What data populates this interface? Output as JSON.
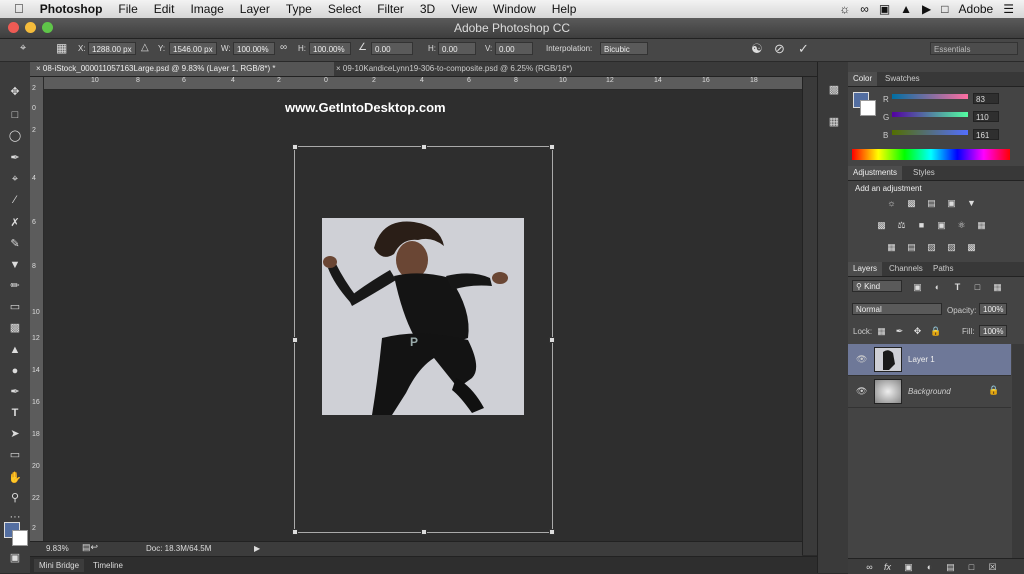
{
  "menubar": {
    "app": "Photoshop",
    "items": [
      "File",
      "Edit",
      "Image",
      "Layer",
      "Type",
      "Select",
      "Filter",
      "3D",
      "View",
      "Window",
      "Help"
    ],
    "right_label": "Adobe"
  },
  "window": {
    "title": "Adobe Photoshop CC"
  },
  "options_bar": {
    "x_label": "X:",
    "x_value": "1288.00 px",
    "y_label": "Y:",
    "y_value": "1546.00 px",
    "w_label": "W:",
    "w_value": "100.00%",
    "h_label": "H:",
    "h_value": "100.00%",
    "angle_value": "0.00",
    "hskew_label": "H:",
    "hskew_value": "0.00",
    "vskew_label": "V:",
    "vskew_value": "0.00",
    "interpolation_label": "Interpolation:",
    "interpolation_value": "Bicubic",
    "workspace": "Essentials"
  },
  "tabs": [
    {
      "label": "08-iStock_000011057163Large.psd @ 9.83% (Layer 1, RGB/8*) *",
      "active": true
    },
    {
      "label": "09-10KandiceLynn19-306-to-composite.psd @ 6.25% (RGB/16*)",
      "active": false
    }
  ],
  "ruler_top": [
    "10",
    "8",
    "6",
    "4",
    "2",
    "0",
    "2",
    "4",
    "6",
    "8",
    "10",
    "12",
    "14",
    "16",
    "18"
  ],
  "ruler_left": [
    "2",
    "0",
    "2",
    "4",
    "6",
    "8",
    "10",
    "12",
    "14",
    "16",
    "18",
    "20",
    "22",
    "2"
  ],
  "watermark": "www.GetIntoDesktop.com",
  "status": {
    "zoom": "9.83%",
    "doc": "Doc: 18.3M/64.5M"
  },
  "bottom_tabs": [
    "Mini Bridge",
    "Timeline"
  ],
  "color_panel": {
    "tabs": [
      "Color",
      "Swatches"
    ],
    "channels": [
      {
        "label": "R",
        "value": "83"
      },
      {
        "label": "G",
        "value": "110"
      },
      {
        "label": "B",
        "value": "161"
      }
    ],
    "foreground": "#536ea1"
  },
  "adjustments_panel": {
    "tabs": [
      "Adjustments",
      "Styles"
    ],
    "heading": "Add an adjustment"
  },
  "layers_panel": {
    "tabs": [
      "Layers",
      "Channels",
      "Paths"
    ],
    "filter": "Kind",
    "blend_mode": "Normal",
    "opacity_label": "Opacity:",
    "opacity_value": "100%",
    "lock_label": "Lock:",
    "fill_label": "Fill:",
    "fill_value": "100%",
    "layers": [
      {
        "name": "Layer 1",
        "selected": true
      },
      {
        "name": "Background",
        "selected": false
      }
    ]
  }
}
